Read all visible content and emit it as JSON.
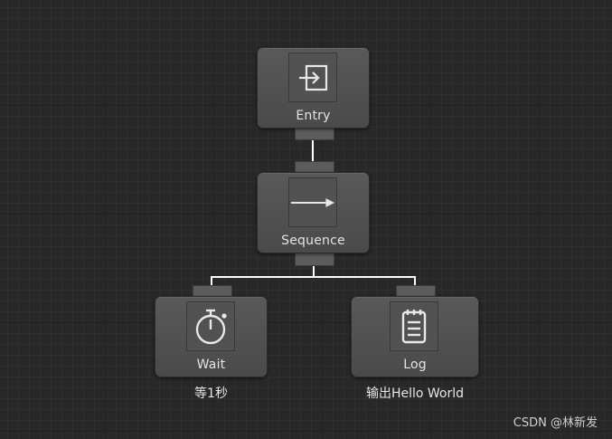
{
  "nodes": {
    "entry": {
      "label": "Entry",
      "icon": "entry-icon"
    },
    "sequence": {
      "label": "Sequence",
      "icon": "arrow-right-icon"
    },
    "wait": {
      "label": "Wait",
      "icon": "stopwatch-icon",
      "comment": "等1秒"
    },
    "log": {
      "label": "Log",
      "icon": "notepad-icon",
      "comment": "输出Hello World"
    }
  },
  "watermark": "CSDN @林新发",
  "colors": {
    "background": "#282828",
    "node": "#4f4f4f",
    "wire": "#ffffff",
    "port": "#5c5c5c"
  }
}
